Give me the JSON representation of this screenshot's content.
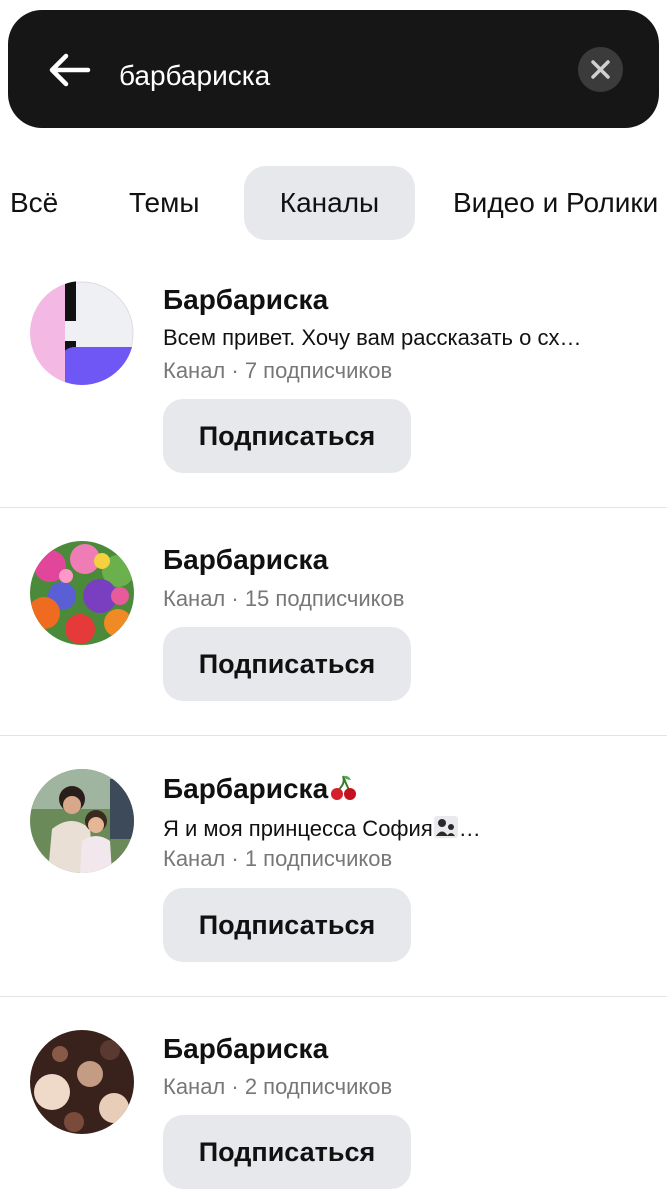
{
  "search": {
    "query": "барбариска"
  },
  "tabs": [
    {
      "label": "Всё",
      "active": false
    },
    {
      "label": "Темы",
      "active": false
    },
    {
      "label": "Каналы",
      "active": true
    },
    {
      "label": "Видео и Ролики",
      "active": false
    }
  ],
  "channels": [
    {
      "name": "Барбариска",
      "description": "Всем привет. Хочу вам рассказать о сх…",
      "meta": "Канал · 7 подписчиков",
      "subscribe_label": "Подписаться"
    },
    {
      "name": "Барбариска",
      "meta": "Канал · 15 подписчиков",
      "subscribe_label": "Подписаться"
    },
    {
      "name": "Барбариска",
      "description": "Я и моя принцесса София",
      "description_suffix": "…",
      "meta": "Канал · 1 подписчиков",
      "subscribe_label": "Подписаться"
    },
    {
      "name": "Барбариска",
      "meta": "Канал · 2 подписчиков",
      "subscribe_label": "Подписаться"
    }
  ],
  "colors": {
    "search_bg": "#161616",
    "chip_bg": "#e7e8ec",
    "meta_text": "#777777",
    "avatar1_purple": "#6e57f5",
    "avatar1_pink": "#f4b8e4"
  }
}
